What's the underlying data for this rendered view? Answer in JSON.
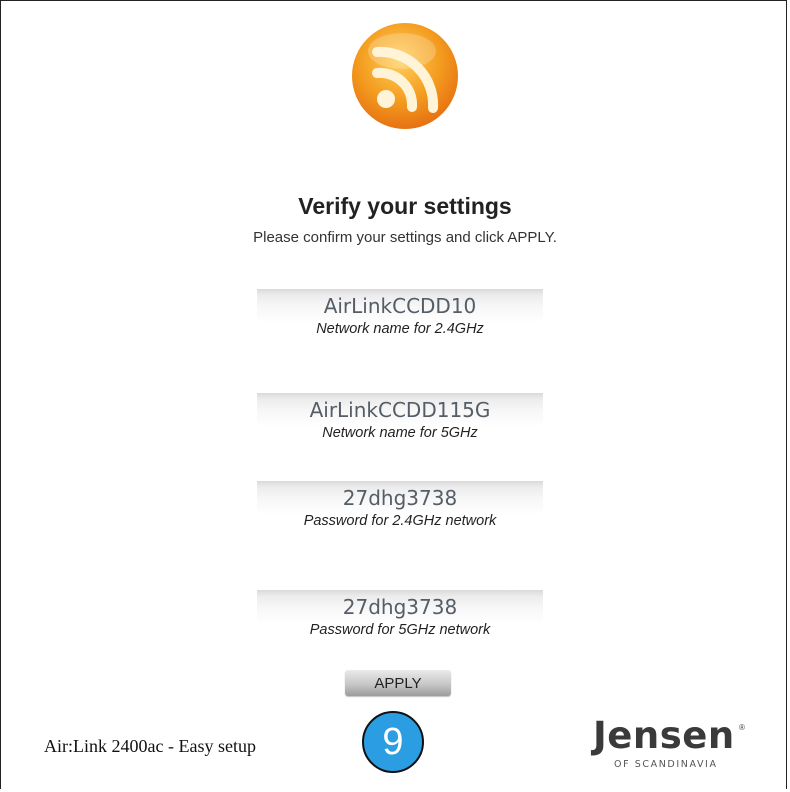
{
  "header": {
    "title": "Verify your settings",
    "subtitle": "Please confirm your settings and click APPLY."
  },
  "fields": [
    {
      "value": "AirLinkCCDD10",
      "label": "Network name for 2.4GHz"
    },
    {
      "value": "AirLinkCCDD115G",
      "label": "Network name for 5GHz"
    },
    {
      "value": "27dhg3738",
      "label": "Password for 2.4GHz network"
    },
    {
      "value": "27dhg3738",
      "label": "Password for 5GHz network"
    }
  ],
  "apply_label": "APPLY",
  "footer": {
    "product": "Air:Link 2400ac - Easy setup",
    "step": "9",
    "brand_name": "Jensen",
    "brand_reg": "®",
    "brand_sub": "OF SCANDINAVIA"
  },
  "icons": {
    "logo": "wifi-signal-orange-icon"
  },
  "colors": {
    "logo_orange": "#f08a1c",
    "step_badge": "#2b9de2",
    "value_text": "#555d66"
  }
}
